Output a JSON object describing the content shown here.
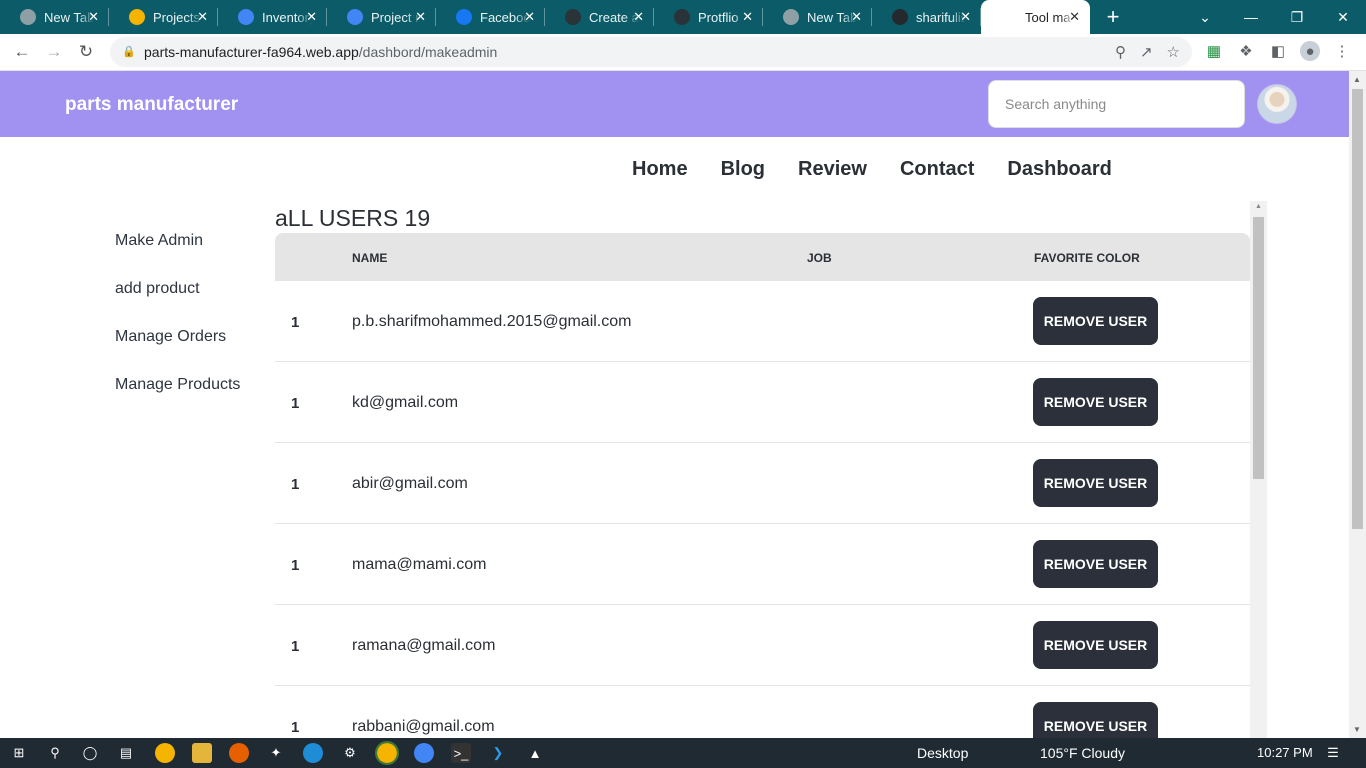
{
  "browser": {
    "tabs": [
      {
        "label": "New Tab",
        "icon": "chrome-icon",
        "color": "#8ea0a6"
      },
      {
        "label": "Projects",
        "icon": "drive-icon",
        "color": "#f4b400"
      },
      {
        "label": "Inventory",
        "icon": "docs-icon",
        "color": "#4285f4"
      },
      {
        "label": "Project r",
        "icon": "docs-icon",
        "color": "#4285f4"
      },
      {
        "label": "Facebook",
        "icon": "facebook-icon",
        "color": "#1877f2"
      },
      {
        "label": "Create a",
        "icon": "react-icon",
        "color": "#2a3338"
      },
      {
        "label": "Protflio",
        "icon": "react-icon",
        "color": "#2a3338"
      },
      {
        "label": "New Tab",
        "icon": "chrome-icon",
        "color": "#8ea0a6"
      },
      {
        "label": "sharifulis",
        "icon": "github-icon",
        "color": "#24292e"
      },
      {
        "label": "Tool ma",
        "icon": "tool-icon",
        "color": "#ffffff",
        "active": true
      }
    ],
    "url_domain": "parts-manufacturer-fa964.web.app",
    "url_path": "/dashbord/makeadmin"
  },
  "header": {
    "brand": "parts manufacturer",
    "search_placeholder": "Search anything",
    "bg_color": "#a191f1"
  },
  "nav": {
    "items": [
      "Home",
      "Blog",
      "Review",
      "Contact",
      "Dashboard"
    ]
  },
  "sidebar": {
    "items": [
      "Make Admin",
      "add product",
      "Manage Orders",
      "Manage Products"
    ]
  },
  "main": {
    "title": "aLL USERS 19",
    "columns": [
      "NAME",
      "JOB",
      "FAVORITE COLOR"
    ],
    "remove_label": "REMOVE USER",
    "rows": [
      {
        "num": "1",
        "email": "p.b.sharifmohammed.2015@gmail.com"
      },
      {
        "num": "1",
        "email": "kd@gmail.com"
      },
      {
        "num": "1",
        "email": "abir@gmail.com"
      },
      {
        "num": "1",
        "email": "mama@mami.com"
      },
      {
        "num": "1",
        "email": "ramana@gmail.com"
      },
      {
        "num": "1",
        "email": "rabbani@gmail.com"
      }
    ]
  },
  "taskbar": {
    "desktop_label": "Desktop",
    "weather": "105°F  Cloudy",
    "time": "10:27 PM"
  }
}
